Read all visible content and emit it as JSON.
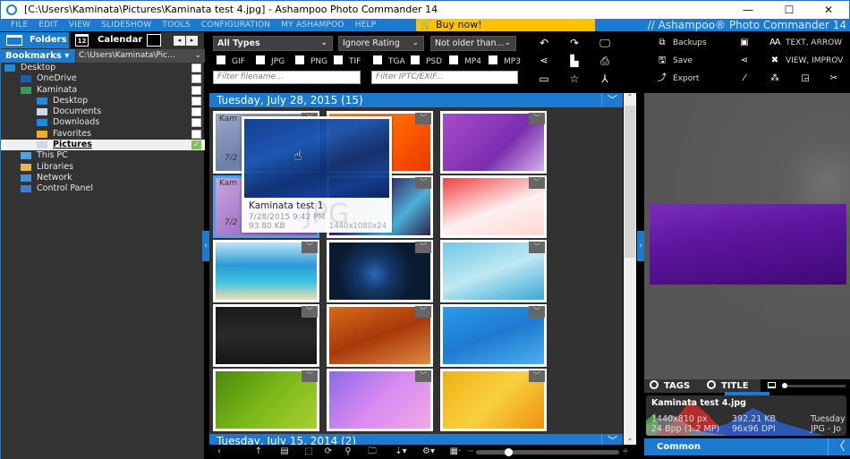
{
  "window": {
    "title": "[C:\\Users\\Kaminata\\Pictures\\Kaminata test 4.jpg] - Ashampoo Photo Commander 14",
    "controls": {
      "minimize": "—",
      "maximize": "☐",
      "close": "✕"
    }
  },
  "menu": {
    "items": [
      "FILE",
      "EDIT",
      "VIEW",
      "SLIDESHOW",
      "TOOLS",
      "CONFIGURATION",
      "MY ASHAMPOO",
      "HELP"
    ],
    "buy_now": "Buy now!",
    "brand": "// Ashampoo® Photo Commander 14"
  },
  "left_panel": {
    "tabs": {
      "folders": "Folders",
      "calendar": "Calendar",
      "calendar_day": "12"
    },
    "bookmarks": "Bookmarks ▾",
    "path": "C:\\Users\\Kaminata\\Pic...",
    "tree": [
      {
        "label": "Desktop",
        "level": 0,
        "icon": "desktop-icon",
        "checked": false,
        "selected": false
      },
      {
        "label": "OneDrive",
        "level": 1,
        "icon": "onedrive-icon",
        "checked": false,
        "selected": false
      },
      {
        "label": "Kaminata",
        "level": 1,
        "icon": "user-icon",
        "checked": false,
        "selected": false
      },
      {
        "label": "Desktop",
        "level": 2,
        "icon": "desktop-icon",
        "checked": false,
        "selected": false
      },
      {
        "label": "Documents",
        "level": 2,
        "icon": "documents-icon",
        "checked": false,
        "selected": false
      },
      {
        "label": "Downloads",
        "level": 2,
        "icon": "downloads-icon",
        "checked": false,
        "selected": false
      },
      {
        "label": "Favorites",
        "level": 2,
        "icon": "star-icon",
        "checked": false,
        "selected": false
      },
      {
        "label": "Pictures",
        "level": 2,
        "icon": "pictures-icon",
        "checked": true,
        "selected": true
      },
      {
        "label": "This PC",
        "level": 1,
        "icon": "computer-icon"
      },
      {
        "label": "Libraries",
        "level": 1,
        "icon": "libraries-icon"
      },
      {
        "label": "Network",
        "level": 1,
        "icon": "network-icon"
      },
      {
        "label": "Control Panel",
        "level": 1,
        "icon": "control-panel-icon"
      }
    ]
  },
  "filters": {
    "type": "All Types",
    "rating": "Ignore Rating",
    "age": "Not older than...",
    "file_types": [
      "GIF",
      "JPG",
      "PNG",
      "TIF",
      "TGA",
      "PSD",
      "MP4",
      "MP3"
    ],
    "filename_placeholder": "Filter filename...",
    "iptc_placeholder": "Filter IPTC/EXIF..."
  },
  "gallery": {
    "groups": [
      {
        "header": "Tuesday, July 28, 2015 (15)"
      },
      {
        "header": "Tuesday, July 15, 2014 (2)"
      }
    ],
    "thumb_label_partial": "Kam",
    "thumb_date_partial": "7/2",
    "tooltip": {
      "name": "Kaminata test 1",
      "date": "7/28/2015 9:42 PM",
      "size": "93.80 KB",
      "dimensions": "1440x1080x24",
      "type_watermark": "JPG"
    }
  },
  "right_toolbar": {
    "backups": "Backups",
    "save": "Save",
    "export": "Export",
    "text_arrow": "TEXT, ARROW",
    "view_improve": "VIEW, IMPROV"
  },
  "right_panel": {
    "tags": "TAGS",
    "title": "TITLE",
    "info": {
      "filename": "Kaminata test 4.jpg",
      "resolution": "1440x810 px",
      "depth": "24 Bpp (1.2 MP)",
      "filesize": "392.21 KB",
      "dpi": "96x96 DPI",
      "date": "Tuesday",
      "format": "JPG - Jo"
    },
    "common": "Common",
    "back": "〈"
  }
}
